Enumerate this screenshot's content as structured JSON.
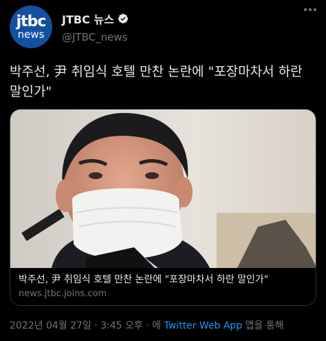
{
  "author": {
    "avatar_top": "jtbc",
    "avatar_bottom": "news",
    "name": "JTBC 뉴스",
    "handle": "@JTBC_news"
  },
  "tweet": {
    "text": "박주선, 尹 취임식 호텔 만찬 논란에 \"포장마차서 하란 말인가\""
  },
  "card": {
    "title": "박주선, 尹 취임식 호텔 만찬 논란에 \"포장마차서 하란 말인가\"",
    "domain": "news.jtbc.joins.com"
  },
  "meta": {
    "timestamp": "2022년 04월 27일 · 3:45 오후 · ",
    "via": "에",
    "source": "Twitter Web App",
    "suffix": " 앱을 통해"
  },
  "colors": {
    "background": "#000000",
    "text": "#e7e9ea",
    "muted": "#71767b",
    "link": "#1d9bf0",
    "avatar": "#1450a0",
    "verified_badge": "#e7e9ea"
  },
  "icons": {
    "verified": "verified-badge-icon",
    "more": "more-options-icon"
  }
}
